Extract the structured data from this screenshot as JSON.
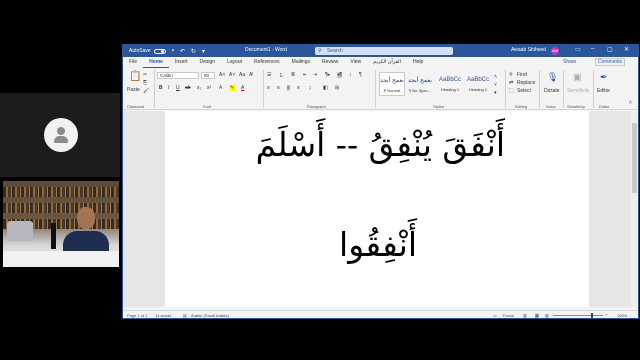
{
  "word": {
    "title_bar": {
      "autosave_label": "AutoSave",
      "autosave_state": "Off",
      "document_title": "Document1 - Word",
      "search_placeholder": "Search",
      "user_name": "Awaab Shiheed",
      "user_initials": "AW"
    },
    "menu_tabs": [
      "File",
      "Home",
      "Insert",
      "Design",
      "Layout",
      "References",
      "Mailings",
      "Review",
      "View",
      "القرآن الكريم",
      "Help"
    ],
    "active_tab": "Home",
    "share_label": "Share",
    "comments_label": "Comments",
    "ribbon": {
      "clipboard": {
        "paste_label": "Paste",
        "group_label": "Clipboard"
      },
      "font": {
        "font_name": "Calibri",
        "font_size": "80",
        "group_label": "Font",
        "format_buttons": [
          "B",
          "I",
          "U",
          "ab",
          "x₂",
          "x²",
          "A",
          "A"
        ]
      },
      "paragraph": {
        "group_label": "Paragraph"
      },
      "styles": {
        "group_label": "Styles",
        "items": [
          {
            "sample": "بعمح أبجد",
            "name": "¶ Normal"
          },
          {
            "sample": "بعمح أبجد",
            "name": "¶ No Spac..."
          },
          {
            "sample": "AaBbCc",
            "name": "Heading 1"
          },
          {
            "sample": "AaBbCc",
            "name": "Heading 2"
          }
        ]
      },
      "editing": {
        "group_label": "Editing",
        "find_label": "Find",
        "replace_label": "Replace",
        "select_label": "Select"
      },
      "voice": {
        "group_label": "Voice",
        "dictate_label": "Dictate"
      },
      "sensitivity": {
        "group_label": "Sensitivity",
        "label": "Sensitivity"
      },
      "editor": {
        "group_label": "Editor",
        "label": "Editor"
      }
    },
    "document": {
      "line1": "أَنْفَقَ يُنْفِقُ  -- أَسْلَمَ",
      "line2": "أَنْفِقُوا"
    },
    "status_bar": {
      "page": "Page 1 of 1",
      "words": "14 words",
      "language": "Arabic (Saudi Arabia)",
      "focus": "Focus",
      "zoom": "100%"
    }
  }
}
